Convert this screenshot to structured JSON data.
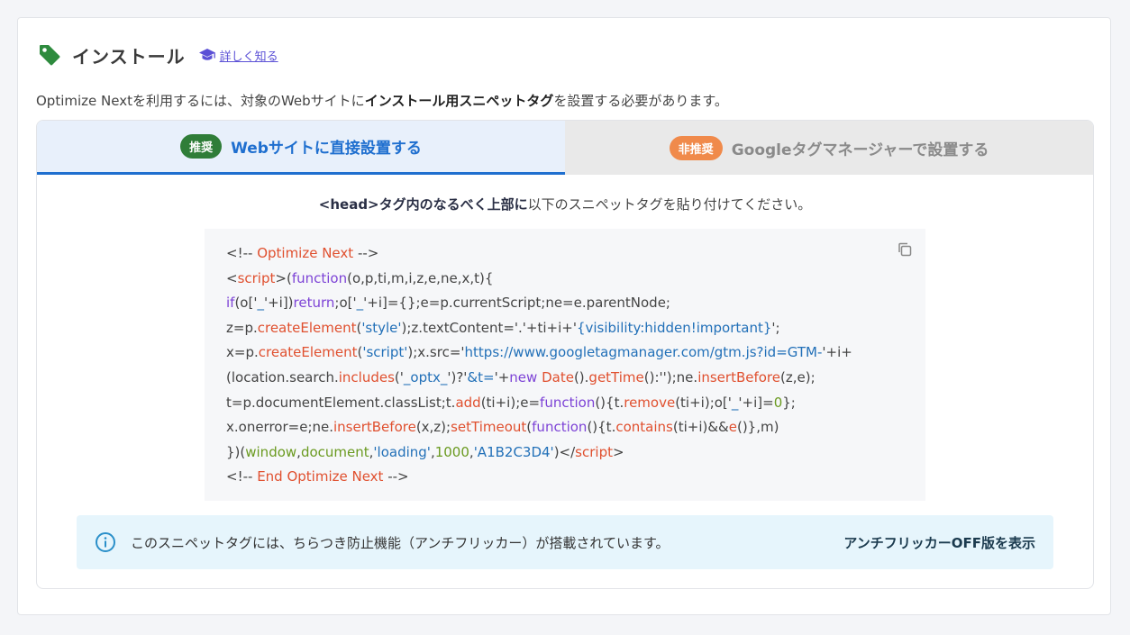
{
  "header": {
    "title": "インストール",
    "learn_more": "詳しく知る"
  },
  "description": {
    "prefix": "Optimize Nextを利用するには、対象のWebサイトに",
    "bold": "インストール用スニペットタグ",
    "suffix": "を設置する必要があります。"
  },
  "tabs": [
    {
      "badge": "推奨",
      "label": "Webサイトに直接設置する"
    },
    {
      "badge": "非推奨",
      "label": "Googleタグマネージャーで設置する"
    }
  ],
  "instruction": {
    "bold": "<head>タグ内のなるべく上部に",
    "rest": "以下のスニペットタグを貼り付けてください。"
  },
  "code": {
    "l1": [
      "<!-- ",
      "Optimize Next",
      " -->"
    ],
    "l2": [
      "<",
      "script",
      ">(",
      "function",
      "(o,p,ti,m,i,z,e,ne,x,t){"
    ],
    "l3": [
      "if",
      "(o['",
      "_",
      "'+i])",
      "return",
      ";o['",
      "_",
      "'+i]={};e=p.currentScript;ne=e.parentNode;"
    ],
    "l4": [
      "z=p.",
      "createElement",
      "(",
      "'style'",
      ");z.textContent='.'+ti+i+'",
      "{visibility:hidden!important}",
      "';"
    ],
    "l5": [
      "x=p.",
      "createElement",
      "(",
      "'script'",
      ");x.src='",
      "https://www.googletagmanager.com/gtm.js?id=GTM-",
      "'+i+"
    ],
    "l6": [
      "(location.search.",
      "includes",
      "('",
      "_optx_",
      "')?'",
      "&t=",
      "'+",
      "new",
      " ",
      "Date",
      "().",
      "getTime",
      "():'');ne.",
      "insertBefore",
      "(z,e);"
    ],
    "l7": [
      "t=p.documentElement.classList;t.",
      "add",
      "(ti+i);e=",
      "function",
      "(){t.",
      "remove",
      "(ti+i);o['",
      "_",
      "'+i]=",
      "0",
      "};"
    ],
    "l8": [
      "x.onerror=e;ne.",
      "insertBefore",
      "(x,z);",
      "setTimeout",
      "(",
      "function",
      "(){t.",
      "contains",
      "(ti+i)&&",
      "e",
      "()},m)"
    ],
    "l9": [
      "})(",
      "window",
      ",",
      "document",
      ",",
      "'loading'",
      ",",
      "1000",
      ",",
      "'A1B2C3D4'",
      ")</",
      "script",
      ">"
    ],
    "l10": [
      "<!-- ",
      "End Optimize Next",
      " -->"
    ]
  },
  "info": {
    "text": "このスニペットタグには、ちらつき防止機能（アンチフリッカー）が搭載されています。",
    "link": "アンチフリッカーOFF版を表示"
  },
  "colors": {
    "accent_blue": "#1f6fcf",
    "recommended_green": "#2f7d38",
    "not_recommended_orange": "#f08a4b",
    "tag_icon_green": "#2e8b3e",
    "link_purple": "#5b50d6"
  },
  "icons": {
    "header": "tag-icon",
    "learn": "graduation-cap-icon",
    "copy": "copy-icon",
    "info": "info-circle-icon"
  }
}
